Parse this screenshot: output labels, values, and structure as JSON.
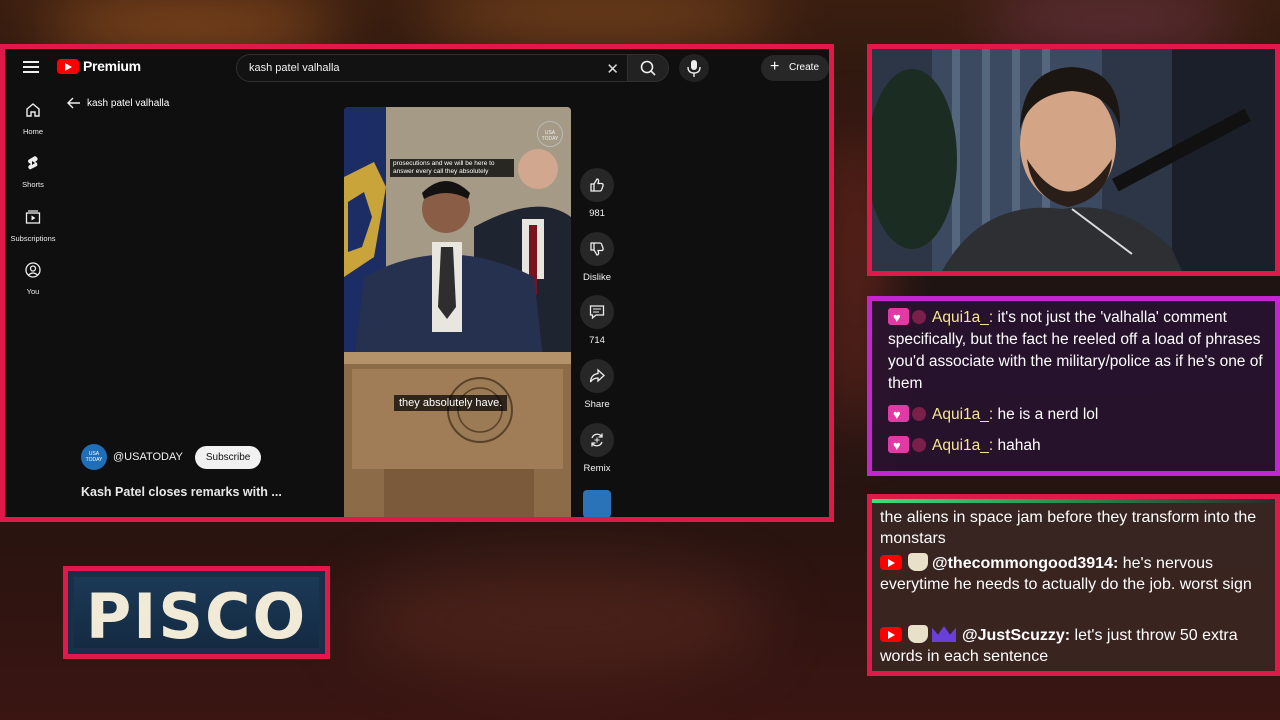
{
  "youtube": {
    "brand": "Premium",
    "search_query": "kash patel valhalla",
    "create_label": "Create",
    "nav": [
      {
        "label": "Home"
      },
      {
        "label": "Shorts"
      },
      {
        "label": "Subscriptions"
      },
      {
        "label": "You"
      }
    ],
    "back_label": "kash patel valhalla",
    "video": {
      "top_caption": "prosecutions and we will be here to answer every call they absolutely",
      "main_caption": "they absolutely have.",
      "watermark": "USA TODAY"
    },
    "actions": {
      "like_count": "981",
      "dislike_label": "Dislike",
      "comment_count": "714",
      "share_label": "Share",
      "remix_label": "Remix"
    },
    "channel": {
      "avatar_text": "USA TODAY",
      "handle": "@USATODAY",
      "subscribe_label": "Subscribe"
    },
    "video_title": "Kash Patel closes remarks with ..."
  },
  "chat_top": {
    "messages": [
      {
        "user": "Aqui1a_:",
        "text": "it's not just the 'valhalla' comment specifically, but the fact he reeled off a load of phrases you'd associate with the military/police as if he's one of them"
      },
      {
        "user": "Aqui1a_:",
        "text": "he is a nerd lol"
      },
      {
        "user": "Aqui1a_:",
        "text": "hahah"
      }
    ]
  },
  "chat_bottom": {
    "continued_text": "the aliens in space jam before they transform into the monstars",
    "messages": [
      {
        "user": "@thecommongood3914:",
        "text": "he's nervous everytime he needs to actually do the job. worst sign"
      },
      {
        "user": "@JustScuzzy:",
        "text": "let's just throw 50 extra words in each sentence"
      }
    ]
  },
  "nameplate": {
    "text": "PISCO"
  },
  "colors": {
    "frame_red": "#e0194b",
    "frame_purple": "#c326d0",
    "username_yellow": "#f6e58d",
    "youtube_red": "#ff0000"
  }
}
